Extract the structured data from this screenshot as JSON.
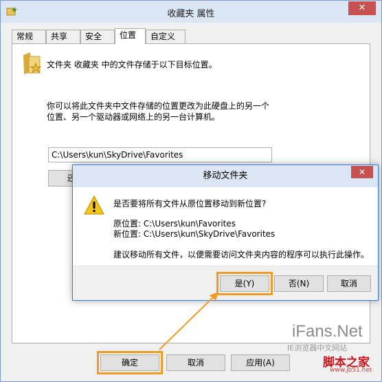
{
  "window": {
    "title": "收藏夹 属性",
    "close_label": "✕"
  },
  "tabs": [
    {
      "label": "常规"
    },
    {
      "label": "共享"
    },
    {
      "label": "安全"
    },
    {
      "label": "位置",
      "active": true
    },
    {
      "label": "自定义"
    }
  ],
  "location": {
    "description": "文件夹 收藏夹 中的文件存储于以下目标位置。",
    "hint_line1": "你可以将此文件夹中文件存储的位置更改为此硬盘上的另一个",
    "hint_line2": "位置、另一个驱动器或网络上的另一台计算机。",
    "path_value": "C:\\Users\\kun\\SkyDrive\\Favorites",
    "restore_label": "还原"
  },
  "footer": {
    "ok_label": "确定",
    "cancel_label": "取消",
    "apply_label": "应用(A)"
  },
  "dialog": {
    "title": "移动文件夹",
    "close_label": "✕",
    "question": "是否要将所有文件从原位置移动到新位置?",
    "old_location": "原位置: C:\\Users\\kun\\Favorites",
    "new_location": "新位置: C:\\Users\\kun\\SkyDrive\\Favorites",
    "advice": "建议移动所有文件，以便需要访问文件夹内容的程序可以执行此操作。",
    "yes_label": "是(Y)",
    "no_label": "否(N)",
    "cancel_label": "取消"
  },
  "watermark": {
    "brand": "iFans.Net",
    "brand_sub": "IE浏览器中文网站",
    "site": "脚本之家",
    "site_url": "www.jb51.net"
  },
  "colors": {
    "highlight": "#f39a24",
    "title_bar": "#dbe6f4",
    "close_button": "#c75050"
  }
}
